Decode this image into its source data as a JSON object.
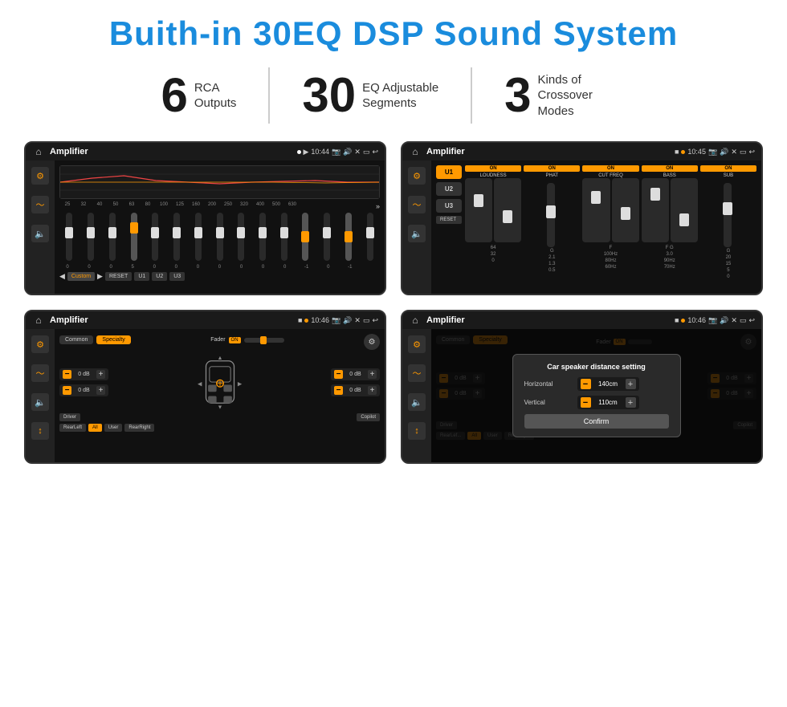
{
  "title": "Buith-in 30EQ DSP Sound System",
  "stats": [
    {
      "number": "6",
      "label": "RCA\nOutputs"
    },
    {
      "number": "30",
      "label": "EQ Adjustable\nSegments"
    },
    {
      "number": "3",
      "label": "Kinds of\nCrossover Modes"
    }
  ],
  "devices": [
    {
      "id": "eq-device",
      "status_bar": {
        "home": "⌂",
        "title": "Amplifier",
        "dots": "● ▶",
        "time": "10:44",
        "icons": "📷 🔊 ✕ ▭ ↩"
      },
      "eq_freqs": [
        "25",
        "32",
        "40",
        "50",
        "63",
        "80",
        "100",
        "125",
        "160",
        "200",
        "250",
        "320",
        "400",
        "500",
        "630"
      ],
      "eq_vals": [
        "0",
        "0",
        "0",
        "5",
        "0",
        "0",
        "0",
        "0",
        "0",
        "0",
        "0",
        "-1",
        "0",
        "-1",
        ""
      ],
      "eq_buttons": [
        "Custom",
        "RESET",
        "U1",
        "U2",
        "U3"
      ],
      "slider_positions": [
        50,
        50,
        50,
        40,
        50,
        50,
        50,
        50,
        50,
        50,
        50,
        55,
        50,
        55,
        50
      ]
    },
    {
      "id": "u-device",
      "status_bar": {
        "title": "Amplifier",
        "dots": "■ ●",
        "time": "10:45"
      },
      "u_buttons": [
        "U1",
        "U2",
        "U3"
      ],
      "channels": [
        {
          "on": true,
          "name": "LOUDNESS"
        },
        {
          "on": true,
          "name": "PHAT"
        },
        {
          "on": true,
          "name": "CUT FREQ"
        },
        {
          "on": true,
          "name": "BASS"
        },
        {
          "on": true,
          "name": "SUB"
        }
      ],
      "reset_label": "RESET"
    },
    {
      "id": "cs-device",
      "status_bar": {
        "title": "Amplifier",
        "dots": "■ ●",
        "time": "10:46"
      },
      "tabs": [
        "Common",
        "Specialty"
      ],
      "active_tab": 1,
      "fader_label": "Fader",
      "fader_on": "ON",
      "db_values": [
        "0 dB",
        "0 dB",
        "0 dB",
        "0 dB"
      ],
      "bottom_btns": [
        "Driver",
        "",
        "Copilot",
        "RearLeft",
        "All",
        "User",
        "RearRight"
      ]
    },
    {
      "id": "dialog-device",
      "status_bar": {
        "title": "Amplifier",
        "dots": "■ ●",
        "time": "10:46"
      },
      "tabs": [
        "Common",
        "Specialty"
      ],
      "dialog": {
        "title": "Car speaker distance setting",
        "horizontal_label": "Horizontal",
        "horizontal_value": "140cm",
        "vertical_label": "Vertical",
        "vertical_value": "110cm",
        "confirm_label": "Confirm"
      },
      "db_values": [
        "0 dB",
        "0 dB"
      ],
      "bottom_btns": [
        "Driver",
        "Copilot",
        "RearLef...",
        "User",
        "RearRight"
      ]
    }
  ],
  "colors": {
    "accent_blue": "#1a8cdd",
    "accent_gold": "#f90000",
    "bg_dark": "#111111",
    "bg_device": "#1a1a1a"
  }
}
